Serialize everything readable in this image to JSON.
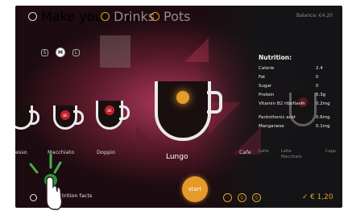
{
  "topbar": {
    "make_your_own": "Make your own",
    "drinks": "Drinks",
    "pots": "Pots",
    "balance": "Balance: €4,20"
  },
  "sizes": [
    "S",
    "M",
    "L"
  ],
  "drinks": {
    "left1": "esso",
    "left2": "Macchiato",
    "left3": "Doppio",
    "main": "Lungo",
    "right1": "Cafe",
    "right2": "Latte",
    "right3": "Latte Macchiato",
    "right4": "Capp"
  },
  "nutrition": {
    "title": "Nutrition:",
    "rows": [
      {
        "label": "Calorie",
        "value": "2.4"
      },
      {
        "label": "Fat",
        "value": "0"
      },
      {
        "label": "Sugar",
        "value": "0"
      },
      {
        "label": "Protein",
        "value": "0.3g"
      },
      {
        "label": "Vitamin B2 riboflavin",
        "value": "0.2mg"
      },
      {
        "label": "Pantothenic acid",
        "value": "0.6mg"
      },
      {
        "label": "Manganese",
        "value": "0.1mg"
      }
    ]
  },
  "footer": {
    "nutrition_facts": "Nutrition facts",
    "start": "start",
    "price": "€ 1,20",
    "check": "✓"
  },
  "cup_logo": "BE",
  "colors": {
    "accent": "#e3a12a",
    "brand_red": "#c0202a"
  }
}
